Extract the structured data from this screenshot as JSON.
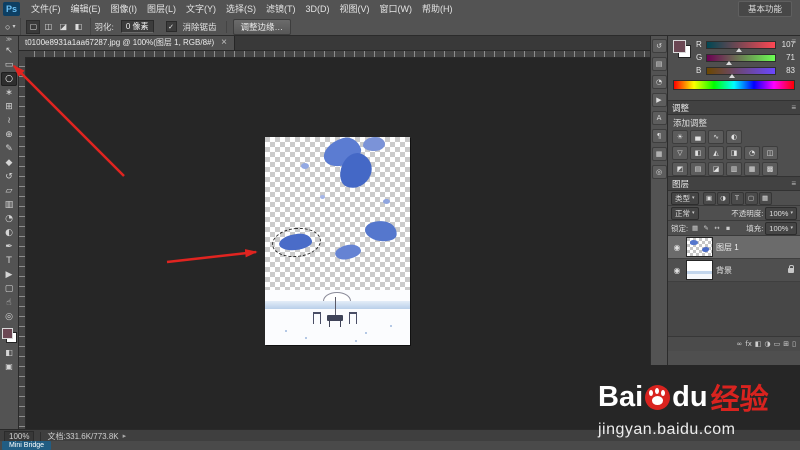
{
  "ui": {
    "caret": "▾",
    "toolbar_collapse": "≫",
    "quick_mask_glyph": "◧",
    "screen_mode_glyph": "▣",
    "panel_menu_glyph": "≡",
    "eye_glyph": "◉",
    "checkbox_check": "✓",
    "status_popup_glyph": "▸"
  },
  "menu": {
    "logo": "Ps",
    "items": [
      "文件(F)",
      "编辑(E)",
      "图像(I)",
      "图层(L)",
      "文字(Y)",
      "选择(S)",
      "滤镜(T)",
      "3D(D)",
      "视图(V)",
      "窗口(W)",
      "帮助(H)"
    ],
    "workspace": "基本功能"
  },
  "options": {
    "tool_glyph": "○",
    "mode_icons": [
      {
        "name": "new-selection-icon",
        "glyph": "▢"
      },
      {
        "name": "add-to-selection-icon",
        "glyph": "◫"
      },
      {
        "name": "subtract-from-selection-icon",
        "glyph": "◪"
      },
      {
        "name": "intersect-selection-icon",
        "glyph": "◧"
      }
    ],
    "feather_label": "羽化:",
    "feather_value": "0 像素",
    "antialias_label": "消除锯齿",
    "refine_edge_label": "调整边缘…"
  },
  "doc_tab": {
    "title": "t0100e8931a1aa67287.jpg @ 100%(图层 1, RGB/8#)",
    "close": "×"
  },
  "tools": [
    {
      "name": "move-tool",
      "glyph": "↖"
    },
    {
      "name": "rectangular-marquee-tool",
      "glyph": "▭"
    },
    {
      "name": "lasso-tool",
      "glyph": "○",
      "selected": true
    },
    {
      "name": "quick-selection-tool",
      "glyph": "∗"
    },
    {
      "name": "crop-tool",
      "glyph": "⊞"
    },
    {
      "name": "eyedropper-tool",
      "glyph": "≀"
    },
    {
      "name": "healing-brush-tool",
      "glyph": "⊕"
    },
    {
      "name": "brush-tool",
      "glyph": "✎"
    },
    {
      "name": "clone-stamp-tool",
      "glyph": "◆"
    },
    {
      "name": "history-brush-tool",
      "glyph": "↺"
    },
    {
      "name": "eraser-tool",
      "glyph": "▱"
    },
    {
      "name": "gradient-tool",
      "glyph": "▥"
    },
    {
      "name": "blur-tool",
      "glyph": "◔"
    },
    {
      "name": "dodge-tool",
      "glyph": "◐"
    },
    {
      "name": "pen-tool",
      "glyph": "✒"
    },
    {
      "name": "type-tool",
      "glyph": "T"
    },
    {
      "name": "path-selection-tool",
      "glyph": "▶"
    },
    {
      "name": "shape-tool",
      "glyph": "▢"
    },
    {
      "name": "hand-tool",
      "glyph": "☝"
    },
    {
      "name": "zoom-tool",
      "glyph": "◎"
    }
  ],
  "rail_icons": [
    {
      "name": "history-panel-icon",
      "glyph": "↺"
    },
    {
      "name": "properties-panel-icon",
      "glyph": "▤"
    },
    {
      "name": "info-panel-icon",
      "glyph": "◔"
    },
    {
      "name": "actions-panel-icon",
      "glyph": "▶"
    },
    {
      "name": "character-panel-icon",
      "glyph": "A"
    },
    {
      "name": "paragraph-panel-icon",
      "glyph": "¶"
    },
    {
      "name": "swatches-panel-icon",
      "glyph": "▦"
    },
    {
      "name": "navigator-panel-icon",
      "glyph": "◎"
    }
  ],
  "color_panel": {
    "channels": [
      {
        "label": "R",
        "value": "107"
      },
      {
        "label": "G",
        "value": "71"
      },
      {
        "label": "B",
        "value": "83"
      }
    ]
  },
  "adjustments": {
    "tab": "调整",
    "add_label": "添加调整",
    "row1": [
      {
        "name": "brightness-contrast-icon",
        "glyph": "☀"
      },
      {
        "name": "levels-icon",
        "glyph": "▄"
      },
      {
        "name": "curves-icon",
        "glyph": "∿"
      },
      {
        "name": "exposure-icon",
        "glyph": "◐"
      }
    ],
    "row2": [
      {
        "name": "vibrance-icon",
        "glyph": "▽"
      },
      {
        "name": "hue-saturation-icon",
        "glyph": "◧"
      },
      {
        "name": "color-balance-icon",
        "glyph": "◭"
      },
      {
        "name": "black-white-icon",
        "glyph": "◨"
      },
      {
        "name": "photo-filter-icon",
        "glyph": "◔"
      },
      {
        "name": "channel-mixer-icon",
        "glyph": "◫"
      }
    ],
    "row3": [
      {
        "name": "invert-icon",
        "glyph": "◩"
      },
      {
        "name": "posterize-icon",
        "glyph": "▤"
      },
      {
        "name": "threshold-icon",
        "glyph": "◪"
      },
      {
        "name": "gradient-map-icon",
        "glyph": "▥"
      },
      {
        "name": "selective-color-icon",
        "glyph": "▦"
      },
      {
        "name": "color-lookup-icon",
        "glyph": "▩"
      }
    ]
  },
  "layers": {
    "tab": "图层",
    "filter_label": "类型",
    "filter_icons": [
      {
        "name": "filter-pixel-layers-icon",
        "glyph": "▣"
      },
      {
        "name": "filter-adjustment-layers-icon",
        "glyph": "◑"
      },
      {
        "name": "filter-type-layers-icon",
        "glyph": "T"
      },
      {
        "name": "filter-shape-layers-icon",
        "glyph": "▢"
      },
      {
        "name": "filter-smart-objects-icon",
        "glyph": "▦"
      }
    ],
    "blend_mode": "正常",
    "opacity_label": "不透明度:",
    "opacity_value": "100%",
    "lock_label": "锁定:",
    "lock_icons": [
      {
        "name": "lock-transparent-pixels-icon",
        "glyph": "▦"
      },
      {
        "name": "lock-image-pixels-icon",
        "glyph": "✎"
      },
      {
        "name": "lock-position-icon",
        "glyph": "↔"
      },
      {
        "name": "lock-all-icon",
        "glyph": "▪"
      }
    ],
    "fill_label": "填充:",
    "fill_value": "100%",
    "rows": [
      {
        "name": "图层 1"
      },
      {
        "name": "背景"
      }
    ],
    "footer_icons": [
      {
        "name": "link-layers-icon",
        "glyph": "∞"
      },
      {
        "name": "layer-style-icon",
        "glyph": "fx"
      },
      {
        "name": "add-layer-mask-icon",
        "glyph": "◧"
      },
      {
        "name": "new-adjustment-layer-icon",
        "glyph": "◑"
      },
      {
        "name": "new-group-icon",
        "glyph": "▭"
      },
      {
        "name": "new-layer-icon",
        "glyph": "⊞"
      },
      {
        "name": "delete-layer-icon",
        "glyph": "▯"
      }
    ]
  },
  "status": {
    "zoom": "100%",
    "doc_info": "文档:331.6K/773.8K",
    "mini_bridge": "Mini Bridge"
  },
  "watermark": {
    "bai": "Bai",
    "du": "du",
    "suffix": "经验",
    "url": "jingyan.baidu.com"
  }
}
